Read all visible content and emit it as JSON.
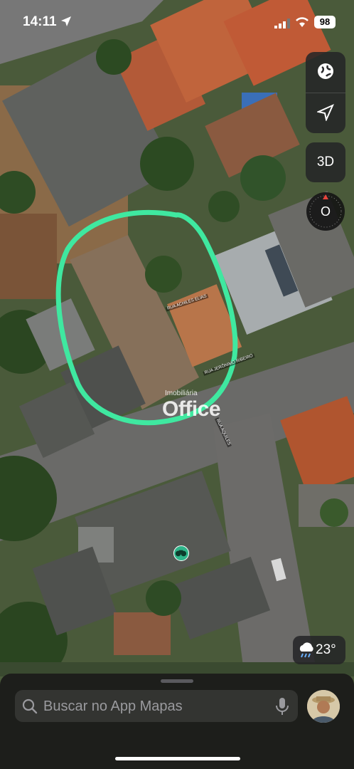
{
  "status_bar": {
    "time": "14:11",
    "battery": "98"
  },
  "map": {
    "watermark_small": "Imobiliária",
    "watermark_big": "Office",
    "street_labels": [
      "RUA ACHILES ELIAS",
      "RUA JERÔNIMO RIBEIRO",
      "RUA AQUILES"
    ]
  },
  "controls": {
    "globe_icon": "globe-icon",
    "location_icon": "location-arrow-icon",
    "three_d_label": "3D",
    "compass_label": "O"
  },
  "weather": {
    "icon": "rain-cloud-icon",
    "temperature": "23°"
  },
  "search": {
    "placeholder": "Buscar no App Mapas",
    "mic_icon": "microphone-icon"
  },
  "colors": {
    "annotation": "#3fe8a0",
    "poi": "#2fb58a"
  }
}
